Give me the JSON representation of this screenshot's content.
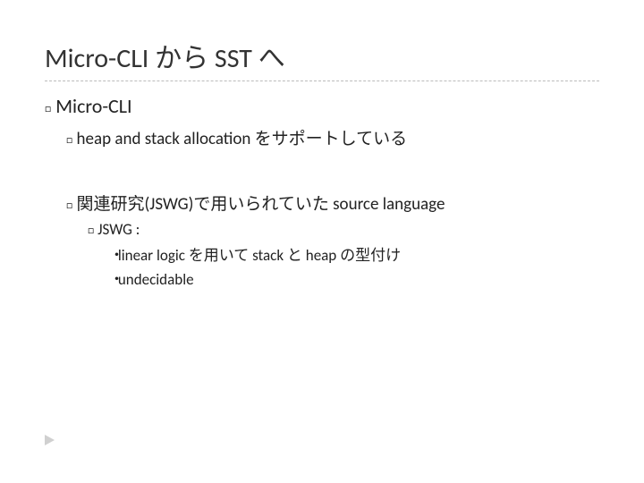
{
  "title": "Micro-CLI から SST へ",
  "section": {
    "heading": "Micro-CLI",
    "point1": "heap and stack allocation をサポートしている",
    "point2": "関連研究(JSWG)で用いられていた source language",
    "sub_heading": "JSWG :",
    "sub_items": [
      "linear logic を用いて stack と heap の型付け",
      "undecidable"
    ]
  },
  "glyphs": {
    "box": "□",
    "dot": "・"
  }
}
